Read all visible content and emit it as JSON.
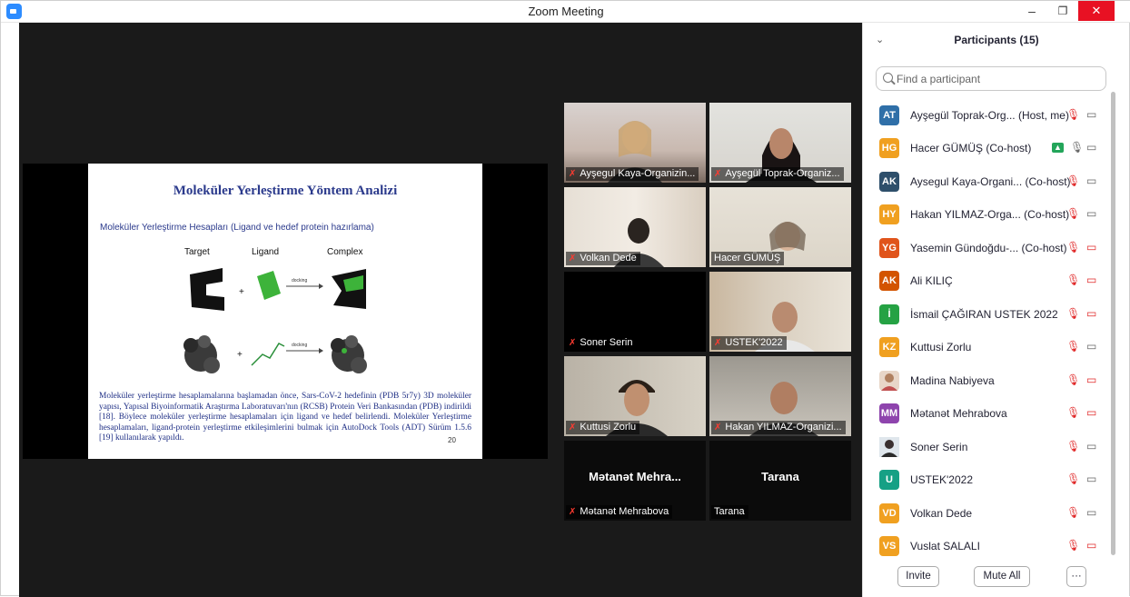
{
  "window": {
    "title": "Zoom Meeting"
  },
  "slide": {
    "title": "Moleküler Yerleştirme Yöntem Analizi",
    "subtitle": "Moleküler Yerleştirme Hesapları (Ligand ve hedef protein hazırlama)",
    "labels": {
      "target": "Target",
      "ligand": "Ligand",
      "complex": "Complex",
      "docking": "docking",
      "plus": "+"
    },
    "body": "Moleküler yerleştirme hesaplamalarına başlamadan önce, Sars-CoV-2 hedefinin (PDB 5r7y) 3D moleküler yapısı, Yapısal Biyoinformatik Araştırma Laboratuvarı'nın (RCSB) Protein Veri Bankasından (PDB) indirildi [18]. Böylece moleküler yerleştirme hesaplamaları için ligand ve hedef belirlendi. Moleküler Yerleştirme hesaplamaları, ligand-protein yerleştirme etkileşimlerini bulmak için AutoDock Tools (ADT) Sürüm 1.5.6 [19] kullanılarak yapıldı.",
    "page": "20"
  },
  "tiles": [
    {
      "name": "Ayşegul Kaya-Organizin..."
    },
    {
      "name": "Ayşegül Toprak-Organiz..."
    },
    {
      "name": "Volkan Dede"
    },
    {
      "name": "Hacer GÜMÜŞ"
    },
    {
      "name": "Soner Serin"
    },
    {
      "name": "USTEK'2022"
    },
    {
      "name": "Kuttusi Zorlu"
    },
    {
      "name": "Hakan YILMAZ-Organizi..."
    },
    {
      "name": "Mətanət Mehrabova",
      "big": "Mətanət  Mehra..."
    },
    {
      "name": "Tarana",
      "big": "Tarana"
    }
  ],
  "panel": {
    "title": "Participants (15)",
    "search_placeholder": "Find a participant",
    "invite": "Invite",
    "mute_all": "Mute All",
    "more": "···"
  },
  "participants": [
    {
      "initials": "AT",
      "color": "#2f6fa8",
      "name": "Ayşegül Toprak-Org... (Host, me)"
    },
    {
      "initials": "HG",
      "color": "#f0a020",
      "name": "Hacer GÜMÜŞ (Co-host)"
    },
    {
      "initials": "AK",
      "color": "#2e4f6b",
      "name": "Aysegul Kaya-Organi... (Co-host)"
    },
    {
      "initials": "HY",
      "color": "#f0a020",
      "name": "Hakan YILMAZ-Orga... (Co-host)"
    },
    {
      "initials": "YG",
      "color": "#e0541b",
      "name": "Yasemin Gündoğdu-... (Co-host)"
    },
    {
      "initials": "AK",
      "color": "#d35400",
      "name": "Ali KILIÇ"
    },
    {
      "initials": "İ",
      "color": "#25a244",
      "name": "İsmail ÇAĞIRAN  USTEK 2022"
    },
    {
      "initials": "KZ",
      "color": "#f0a020",
      "name": "Kuttusi Zorlu"
    },
    {
      "initials": "",
      "color": "#e8d6c8",
      "name": "Madina Nabiyeva"
    },
    {
      "initials": "MM",
      "color": "#8e44ad",
      "name": "Mətanət Mehrabova"
    },
    {
      "initials": "",
      "color": "#556677",
      "name": "Soner Serin"
    },
    {
      "initials": "U",
      "color": "#16a085",
      "name": "USTEK'2022"
    },
    {
      "initials": "VD",
      "color": "#f0a020",
      "name": "Volkan Dede"
    },
    {
      "initials": "VS",
      "color": "#f0a020",
      "name": "Vuslat SALALI"
    }
  ]
}
